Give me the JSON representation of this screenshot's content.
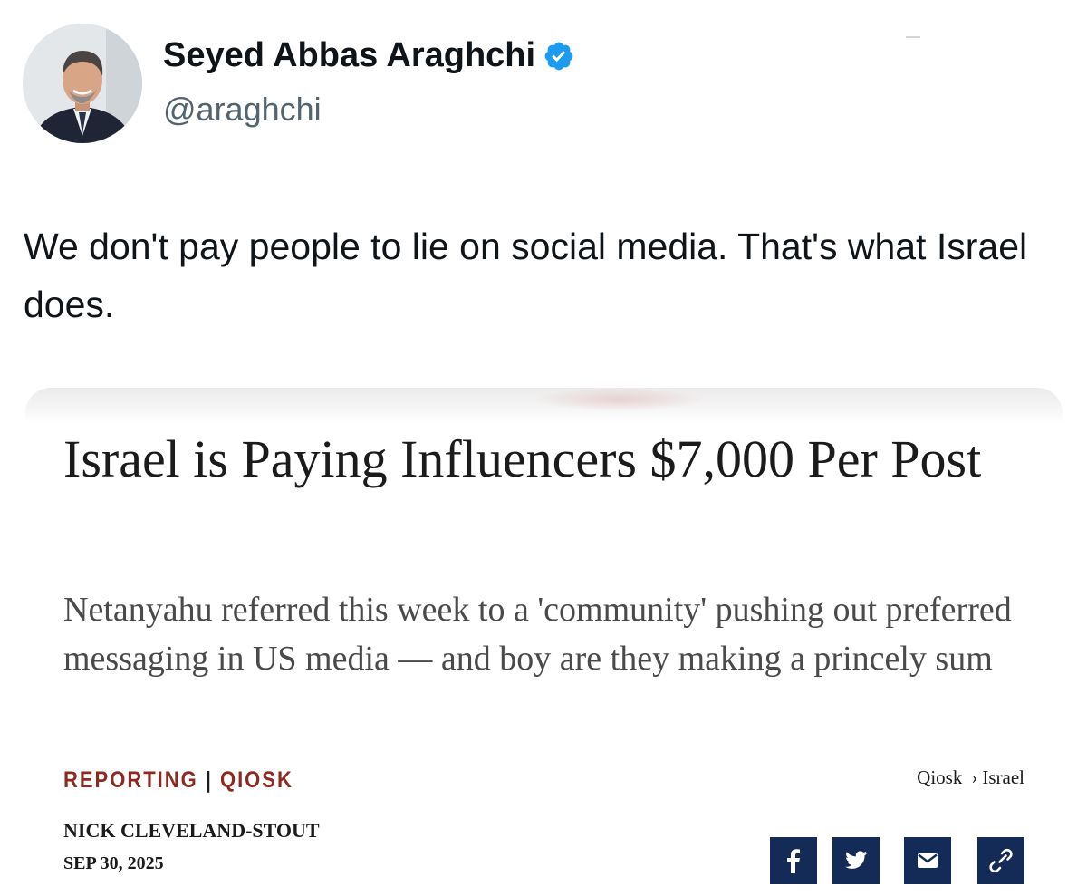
{
  "author": {
    "display_name": "Seyed Abbas Araghchi",
    "handle": "@araghchi",
    "verified": true,
    "avatar_icon": "profile-photo"
  },
  "tweet": {
    "text": "We don't pay people to lie on social media. That's what Israel does."
  },
  "article_card": {
    "headline": "Israel is Paying Influencers $7,000 Per Post",
    "subheadline": "Netanyahu referred this week to a 'community' pushing out preferred messaging in US media — and boy are they making a princely sum",
    "section": "REPORTING",
    "section_separator": "|",
    "outlet": "QIOSK",
    "breadcrumb": {
      "parent": "Qiosk",
      "separator": "›",
      "current": "Israel"
    },
    "byline": "NICK CLEVELAND-STOUT",
    "date": "SEP 30, 2025",
    "share_buttons": [
      {
        "icon": "facebook-icon"
      },
      {
        "icon": "twitter-icon"
      },
      {
        "icon": "email-icon"
      },
      {
        "icon": "link-icon"
      }
    ]
  },
  "colors": {
    "verified_blue": "#1d9bf0",
    "handle_gray": "#536471",
    "section_red": "#8c2a22",
    "share_navy": "#142a57"
  }
}
